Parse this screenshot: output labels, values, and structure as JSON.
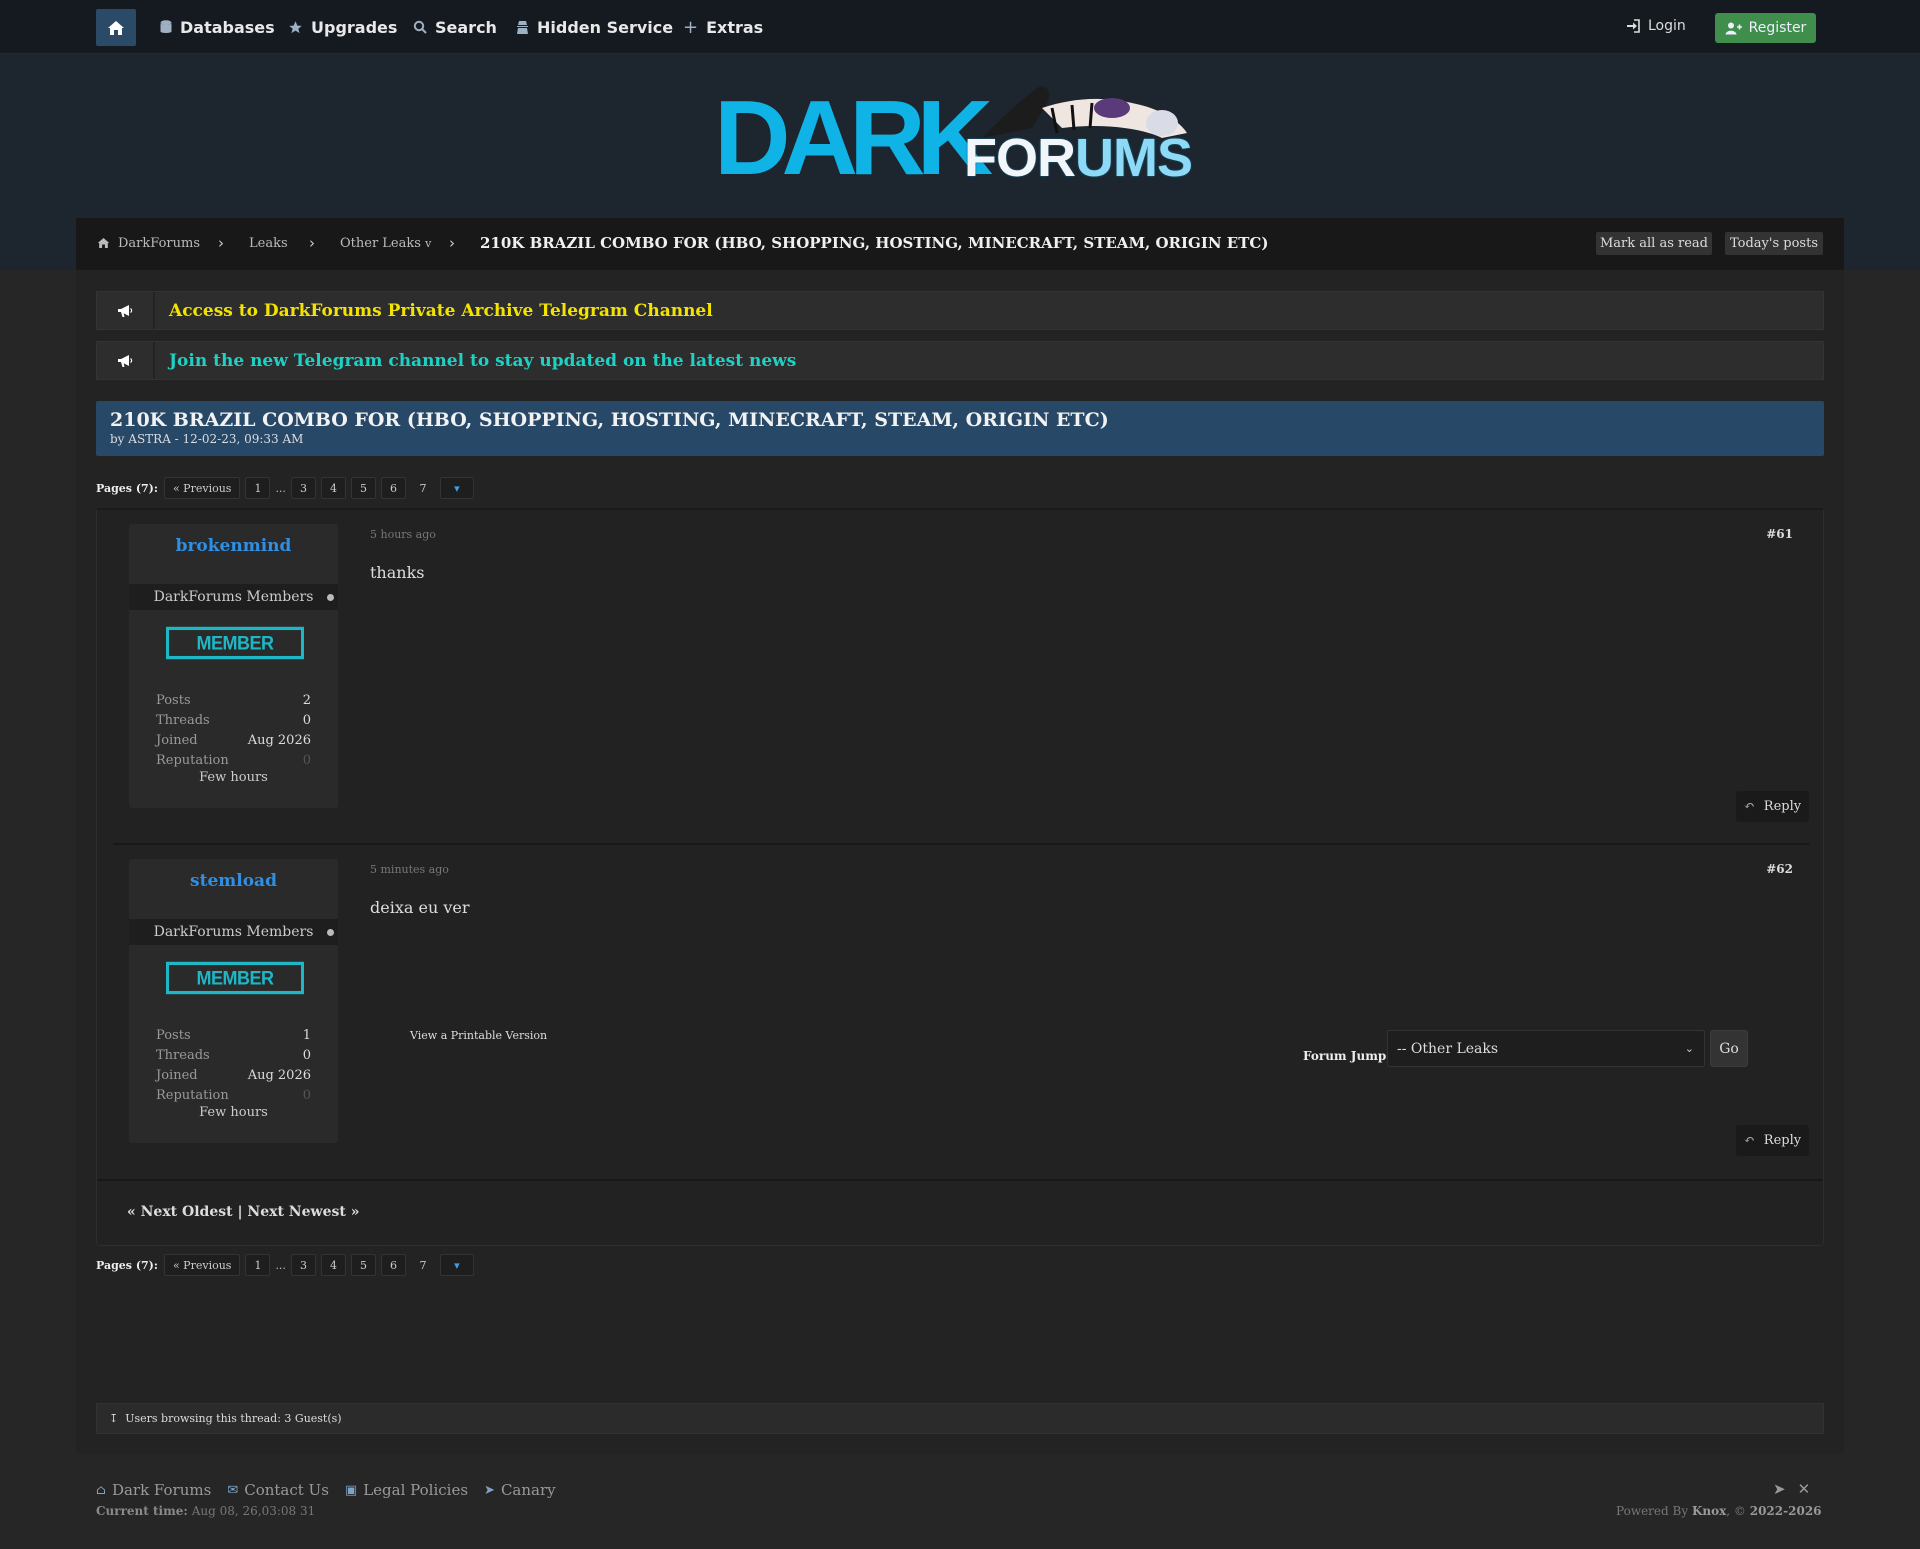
{
  "nav": {
    "items": [
      {
        "label": "Databases",
        "icon": "database-icon"
      },
      {
        "label": "Upgrades",
        "icon": "star-icon"
      },
      {
        "label": "Search",
        "icon": "search-icon"
      },
      {
        "label": "Hidden Service",
        "icon": "hidden-service-icon"
      },
      {
        "label": "Extras",
        "icon": "plus-icon"
      }
    ],
    "login": "Login",
    "register": "Register"
  },
  "logo": {
    "dark": "DARK",
    "forums_a": "FOR",
    "forums_b": "UMS"
  },
  "breadcrumb": {
    "home": "DarkForums",
    "leaks": "Leaks",
    "other": "Other Leaks",
    "other_suffix": "v",
    "current": "210K BRAZIL COMBO FOR (HBO, SHOPPING, HOSTING, MINECRAFT, STEAM, ORIGIN ETC)",
    "mark_all_read": "Mark all as read",
    "todays_posts": "Today's posts"
  },
  "announcements": [
    {
      "text": "Access to DarkForums Private Archive Telegram Channel",
      "color": "#f2e300"
    },
    {
      "text": "Join the new Telegram channel to stay updated on the latest news",
      "color": "#1fd1c4"
    }
  ],
  "thread": {
    "title": "210K BRAZIL COMBO FOR (HBO, SHOPPING, HOSTING, MINECRAFT, STEAM, ORIGIN ETC)",
    "byline": "by ASTRA - 12-02-23, 09:33 AM"
  },
  "pagination": {
    "label": "Pages (7):",
    "prev": "« Previous",
    "pages": [
      "1",
      "...",
      "3",
      "4",
      "5",
      "6",
      "7"
    ],
    "current": "7"
  },
  "posts": [
    {
      "username": "brokenmind",
      "group": "DarkForums Members",
      "badge": "MEMBER",
      "stats": [
        {
          "k": "Posts",
          "v": "2"
        },
        {
          "k": "Threads",
          "v": "0"
        },
        {
          "k": "Joined",
          "v": "Aug 2026"
        },
        {
          "k": "Reputation",
          "v": "0"
        }
      ],
      "last_seen": "Few hours",
      "date": "5 hours ago",
      "number": "#61",
      "body": "thanks",
      "reply": "Reply"
    },
    {
      "username": "stemload",
      "group": "DarkForums Members",
      "badge": "MEMBER",
      "stats": [
        {
          "k": "Posts",
          "v": "1"
        },
        {
          "k": "Threads",
          "v": "0"
        },
        {
          "k": "Joined",
          "v": "Aug 2026"
        },
        {
          "k": "Reputation",
          "v": "0"
        }
      ],
      "last_seen": "Few hours",
      "date": "5 minutes ago",
      "number": "#62",
      "body": "deixa eu ver",
      "reply": "Reply"
    }
  ],
  "thread_nav": "« Next Oldest | Next Newest »",
  "printable": "View a Printable Version",
  "forum_jump": {
    "label": "Forum Jump:",
    "selected": "-- Other Leaks",
    "go": "Go"
  },
  "browsing": "Users browsing this thread: 3 Guest(s)",
  "footer": {
    "links": [
      {
        "label": "Dark Forums",
        "icon": "home-icon"
      },
      {
        "label": "Contact Us",
        "icon": "envelope-icon"
      },
      {
        "label": "Legal Policies",
        "icon": "briefcase-icon"
      },
      {
        "label": "Canary",
        "icon": "megaphone-icon"
      }
    ],
    "current_time_label": "Current time:",
    "current_time": "Aug 08, 26,03:08 31",
    "powered_prefix": "Powered By",
    "powered_name": "Knox",
    "copyright": ", ©",
    "years": "2022-2026"
  }
}
